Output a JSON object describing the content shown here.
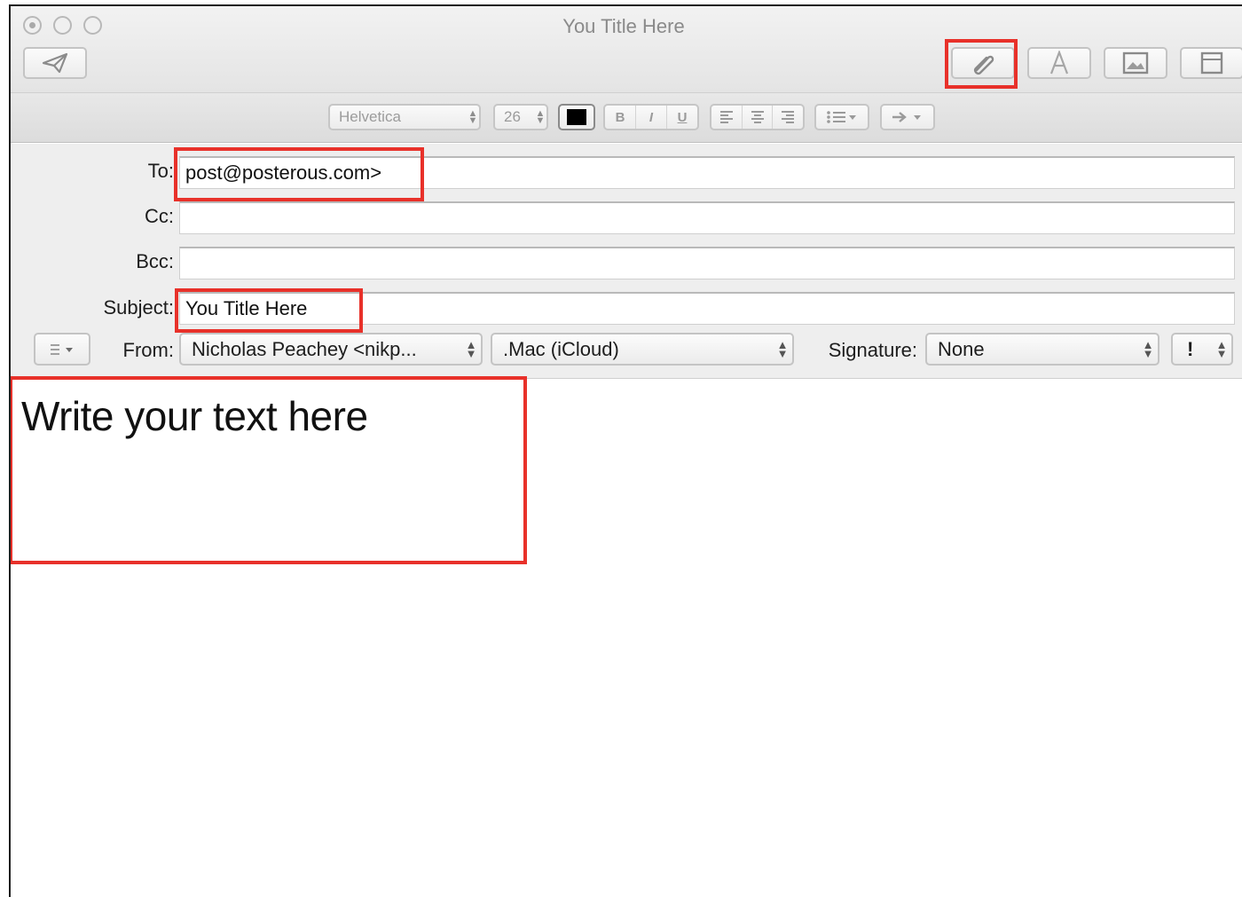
{
  "window": {
    "title": "You Title Here"
  },
  "toolbar": {
    "send_icon": "paper-plane-icon",
    "attach_icon": "paperclip-icon",
    "fonts_icon": "font-a-icon",
    "photo_icon": "photo-browser-icon",
    "template_icon": "stationery-icon"
  },
  "formatbar": {
    "font": "Helvetica",
    "size": "26",
    "color": "#000000",
    "style_buttons": [
      "B",
      "I",
      "U"
    ],
    "align_icons": [
      "align-left-icon",
      "align-center-icon",
      "align-right-icon"
    ],
    "list_icon": "list-icon",
    "indent_icon": "indent-arrow-icon"
  },
  "fields": {
    "to_label": "To:",
    "to_value": "post@posterous.com>",
    "cc_label": "Cc:",
    "cc_value": "",
    "bcc_label": "Bcc:",
    "bcc_value": "",
    "subject_label": "Subject:",
    "subject_value": "You Title Here"
  },
  "options": {
    "header_menu_icon": "list-menu-icon",
    "from_label": "From:",
    "from_value": "Nicholas Peachey <nikp...",
    "account_value": ".Mac (iCloud)",
    "signature_label": "Signature:",
    "signature_value": "None",
    "priority_value": "!"
  },
  "body": {
    "text": "Write your text here"
  },
  "annotations": {
    "highlight_color": "#e8312a"
  }
}
